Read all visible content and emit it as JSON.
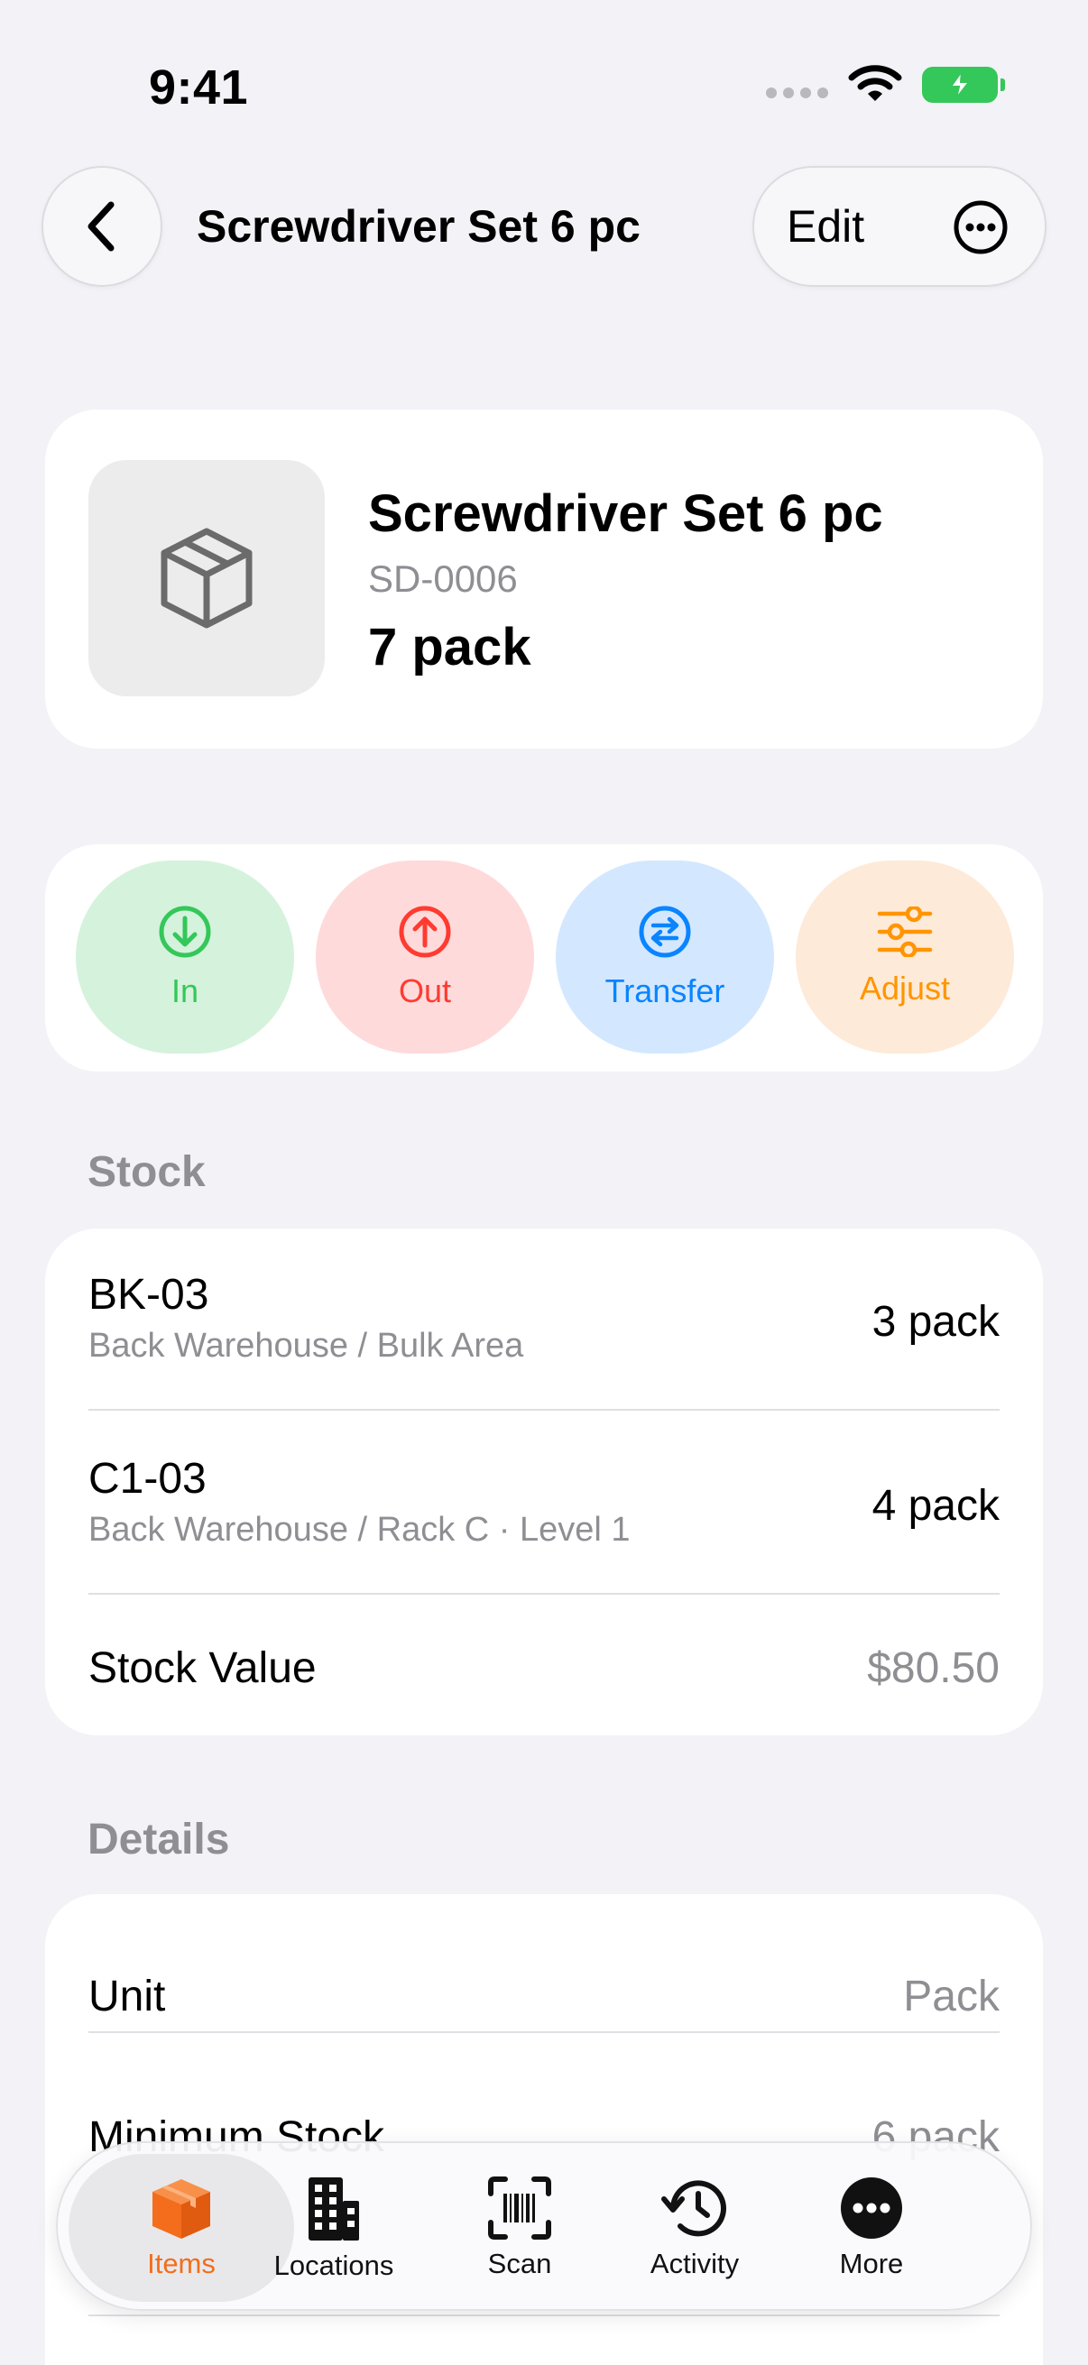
{
  "status_bar": {
    "time": "9:41"
  },
  "nav": {
    "title": "Screwdriver Set 6 pc",
    "edit_label": "Edit"
  },
  "item": {
    "name": "Screwdriver Set 6 pc",
    "sku": "SD-0006",
    "quantity": "7 pack"
  },
  "actions": [
    {
      "label": "In",
      "color": "#34c759"
    },
    {
      "label": "Out",
      "color": "#ff3b30"
    },
    {
      "label": "Transfer",
      "color": "#0a84ff"
    },
    {
      "label": "Adjust",
      "color": "#ff9500"
    }
  ],
  "stock": {
    "section_title": "Stock",
    "rows": [
      {
        "code": "BK-03",
        "path": "Back Warehouse / Bulk Area",
        "qty": "3 pack"
      },
      {
        "code": "C1-03",
        "path": "Back Warehouse / Rack C · Level 1",
        "qty": "4 pack"
      }
    ],
    "value_label": "Stock Value",
    "value": "$80.50"
  },
  "details": {
    "section_title": "Details",
    "rows": [
      {
        "label": "Unit",
        "value": "Pack"
      },
      {
        "label": "Minimum Stock",
        "value": "6 pack"
      }
    ]
  },
  "tabbar": {
    "tabs": [
      {
        "label": "Items",
        "icon": "box-icon",
        "active": true
      },
      {
        "label": "Locations",
        "icon": "building-icon"
      },
      {
        "label": "Scan",
        "icon": "barcode-scan-icon"
      },
      {
        "label": "Activity",
        "icon": "history-clock-icon"
      },
      {
        "label": "More",
        "icon": "ellipsis-circle-icon"
      }
    ],
    "accent": "#f36d1c"
  }
}
